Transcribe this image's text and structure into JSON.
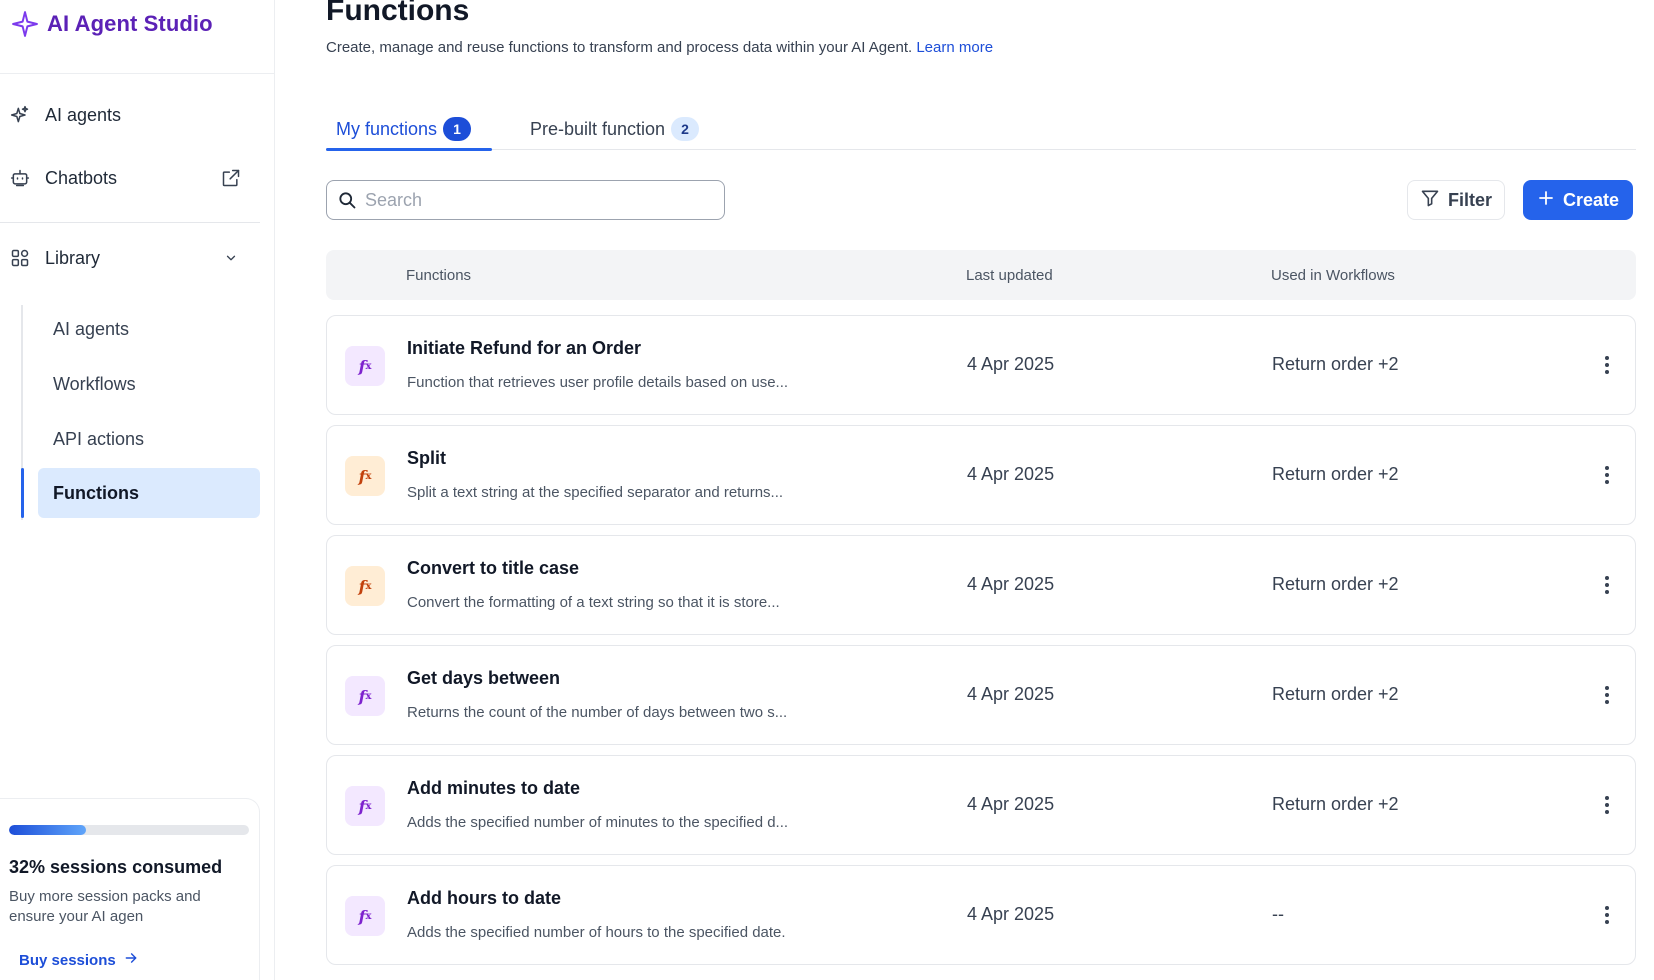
{
  "app": {
    "brand": "AI Agent Studio",
    "brand_icon": "sparkle-icon",
    "accent_color": "#2563eb",
    "brand_color": "#5b21b6"
  },
  "sidebar": {
    "nav": [
      {
        "label": "AI agents",
        "icon": "sparkles-icon"
      },
      {
        "label": "Chatbots",
        "icon": "bot-icon",
        "trail_icon": "external-link-icon"
      },
      {
        "label": "Library",
        "icon": "grid-icon",
        "trail_icon": "chevron-down-icon"
      }
    ],
    "library_items": [
      {
        "label": "AI agents"
      },
      {
        "label": "Workflows"
      },
      {
        "label": "API actions"
      },
      {
        "label": "Functions",
        "active": true
      }
    ],
    "usage": {
      "percent": 32,
      "title": "32% sessions consumed",
      "description": "Buy more session packs and ensure your AI agen",
      "link": "Buy sessions"
    }
  },
  "main": {
    "title": "Functions",
    "description": "Create, manage and reuse functions to transform and process data within your AI Agent.",
    "learn_more": "Learn more",
    "tabs": [
      {
        "label": "My functions",
        "count": "1",
        "active": true
      },
      {
        "label": "Pre-built function",
        "count": "2",
        "active": false
      }
    ],
    "search": {
      "placeholder": "Search",
      "value": ""
    },
    "filter_label": "Filter",
    "create_label": "Create",
    "table": {
      "columns": [
        "Functions",
        "Last updated",
        "Used in Workflows"
      ],
      "rows": [
        {
          "name": "Initiate Refund for an Order",
          "description": "Function that retrieves user profile details based on use...",
          "updated": "4 Apr 2025",
          "used_in": "Return order +2",
          "icon_color": "purple"
        },
        {
          "name": "Split",
          "description": "Split a text string at the specified separator and returns...",
          "updated": "4 Apr 2025",
          "used_in": "Return order +2",
          "icon_color": "orange"
        },
        {
          "name": "Convert to title case",
          "description": "Convert the formatting of a text string so that it is store...",
          "updated": "4 Apr 2025",
          "used_in": "Return order +2",
          "icon_color": "orange"
        },
        {
          "name": "Get days between",
          "description": "Returns the count of the number of days between two s...",
          "updated": "4 Apr 2025",
          "used_in": "Return order +2",
          "icon_color": "purple"
        },
        {
          "name": "Add minutes to date",
          "description": "Adds the specified number of minutes to the specified d...",
          "updated": "4 Apr 2025",
          "used_in": "Return order +2",
          "icon_color": "purple"
        },
        {
          "name": "Add hours to date",
          "description": "Adds the specified number of hours to the specified date.",
          "updated": "4 Apr 2025",
          "used_in": "--",
          "icon_color": "purple"
        }
      ]
    }
  }
}
